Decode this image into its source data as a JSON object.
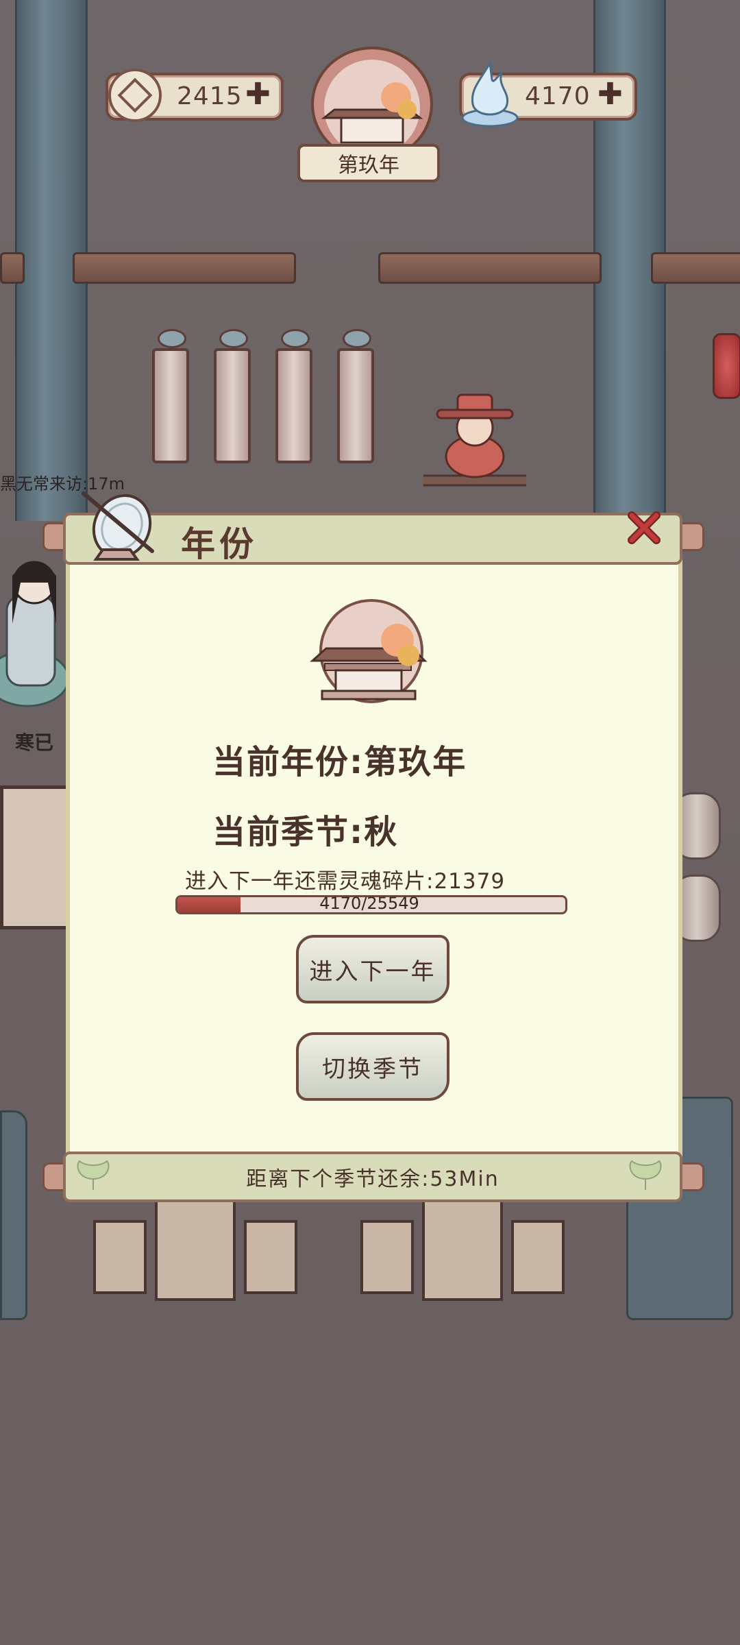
{
  "hud": {
    "coins_value": "2415",
    "soul_value": "4170",
    "year_label": "第玖年"
  },
  "scene": {
    "visitor_notice": "黑无常来访:17m",
    "character_name": "寒已"
  },
  "modal": {
    "title": "年份",
    "current_year_line": "当前年份:第玖年",
    "current_season_line": "当前季节:秋",
    "requirement_line": "进入下一年还需灵魂碎片:21379",
    "progress_text": "4170/25549",
    "progress_fraction": 0.163,
    "next_year_button": "进入下一年",
    "switch_season_button": "切换季节",
    "footer_text": "距离下个季节还余:53Min"
  },
  "icons": {
    "coin": "coin-icon",
    "soul": "soul-flame-icon",
    "close": "close-icon",
    "sundial": "sundial-icon",
    "pavilion": "pavilion-emblem-icon"
  },
  "colors": {
    "modal_bg": "#fafbe5",
    "header_bg": "#d9dcb8",
    "text_brown": "#4a322c",
    "progress_fill": "#c2564c",
    "close_red": "#c23b3b"
  }
}
